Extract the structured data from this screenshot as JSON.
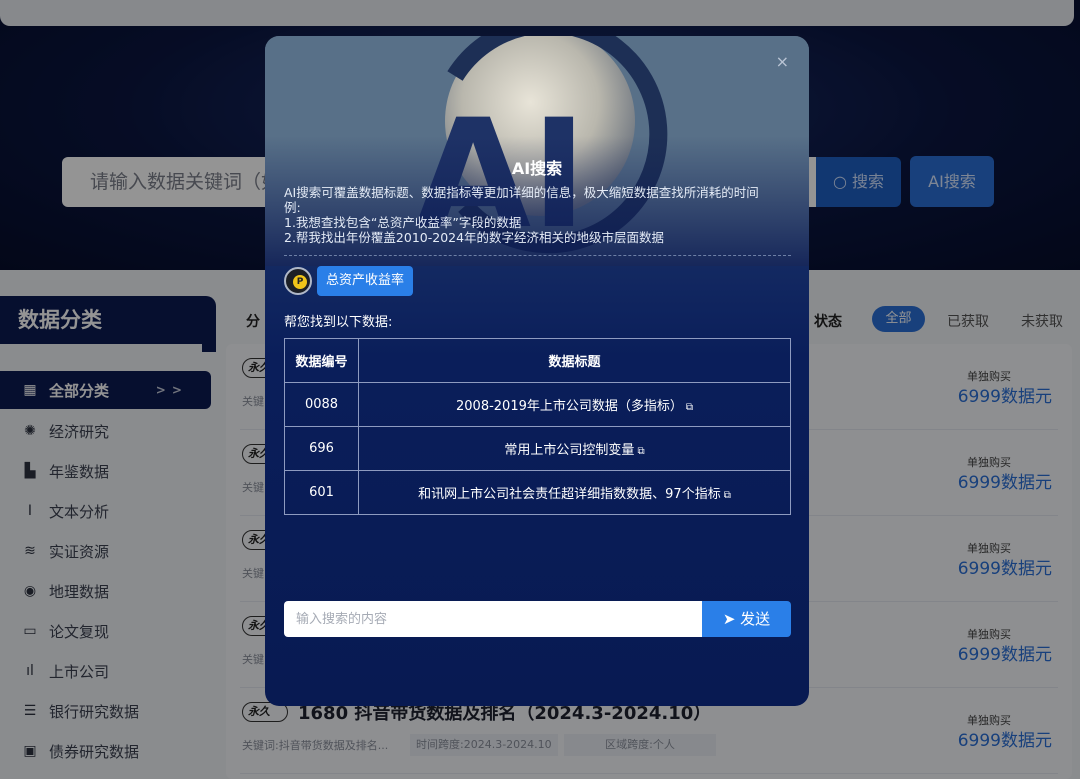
{
  "header": {
    "search_placeholder": "请输入数据关键词（如",
    "search_btn": "搜索",
    "ai_btn": "AI搜索"
  },
  "sidebar": {
    "title": "数据分类",
    "items": [
      {
        "label": "全部分类",
        "icon": "grid-icon",
        "glyph": "▦"
      },
      {
        "label": "经济研究",
        "icon": "sun-icon",
        "glyph": "✺"
      },
      {
        "label": "年鉴数据",
        "icon": "book-icon",
        "glyph": "▙"
      },
      {
        "label": "文本分析",
        "icon": "italic-icon",
        "glyph": "I"
      },
      {
        "label": "实证资源",
        "icon": "layers-icon",
        "glyph": "≋"
      },
      {
        "label": "地理数据",
        "icon": "globe-icon",
        "glyph": "◉"
      },
      {
        "label": "论文复现",
        "icon": "document-icon",
        "glyph": "▭"
      },
      {
        "label": "上市公司",
        "icon": "bar-chart-icon",
        "glyph": "ıl"
      },
      {
        "label": "银行研究数据",
        "icon": "bank-icon",
        "glyph": "☰"
      },
      {
        "label": "债券研究数据",
        "icon": "bond-icon",
        "glyph": "▣"
      }
    ],
    "active_arrow": "> >"
  },
  "filters": {
    "category_label": "分",
    "status_label": "状态",
    "chips": [
      "全部",
      "已获取",
      "未获取"
    ]
  },
  "list": [
    {
      "badge": "永久",
      "title": "",
      "kw": "关键",
      "buy": "单独购买",
      "price": "6999数据元"
    },
    {
      "badge": "永久",
      "title": "",
      "kw": "关键",
      "buy": "单独购买",
      "price": "6999数据元"
    },
    {
      "badge": "永久",
      "title": "",
      "kw": "关键",
      "buy": "单独购买",
      "price": "6999数据元"
    },
    {
      "badge": "永久",
      "title": "",
      "kw": "关键",
      "buy": "单独购买",
      "price": "6999数据元"
    },
    {
      "badge": "永久",
      "title": "1680 抖音带货数据及排名（2024.3-2024.10）",
      "kw": "关键词:抖音带货数据及排名...",
      "span": "时间跨度:2024.3-2024.10",
      "region": "区域跨度:个人",
      "buy": "单独购买",
      "price": "6999数据元"
    }
  ],
  "modal": {
    "art_text": "AI",
    "close": "×",
    "title": "AI搜索",
    "desc_lines": [
      "AI搜索可覆盖数据标题、数据指标等更加详细的信息，极大缩短数据查找所消耗的时间",
      "例:",
      "1.我想查找包含“总资产收益率”字段的数据",
      "2.帮我找出年份覆盖2010-2024年的数字经济相关的地级市层面数据"
    ],
    "avatar_letter": "P",
    "query": "总资产收益率",
    "found_text": "帮您找到以下数据:",
    "table": {
      "headers": [
        "数据编号",
        "数据标题"
      ],
      "rows": [
        {
          "id": "0088",
          "title": "2008-2019年上市公司数据（多指标）"
        },
        {
          "id": "696",
          "title": "常用上市公司控制变量"
        },
        {
          "id": "601",
          "title": "和讯网上市公司社会责任超详细指数数据、97个指标"
        }
      ]
    },
    "input_placeholder": "输入搜索的内容",
    "send_label": "发送"
  },
  "colors": {
    "accent": "#2a7fe8",
    "navy": "#0b1a52",
    "price": "#2a6fd6"
  }
}
